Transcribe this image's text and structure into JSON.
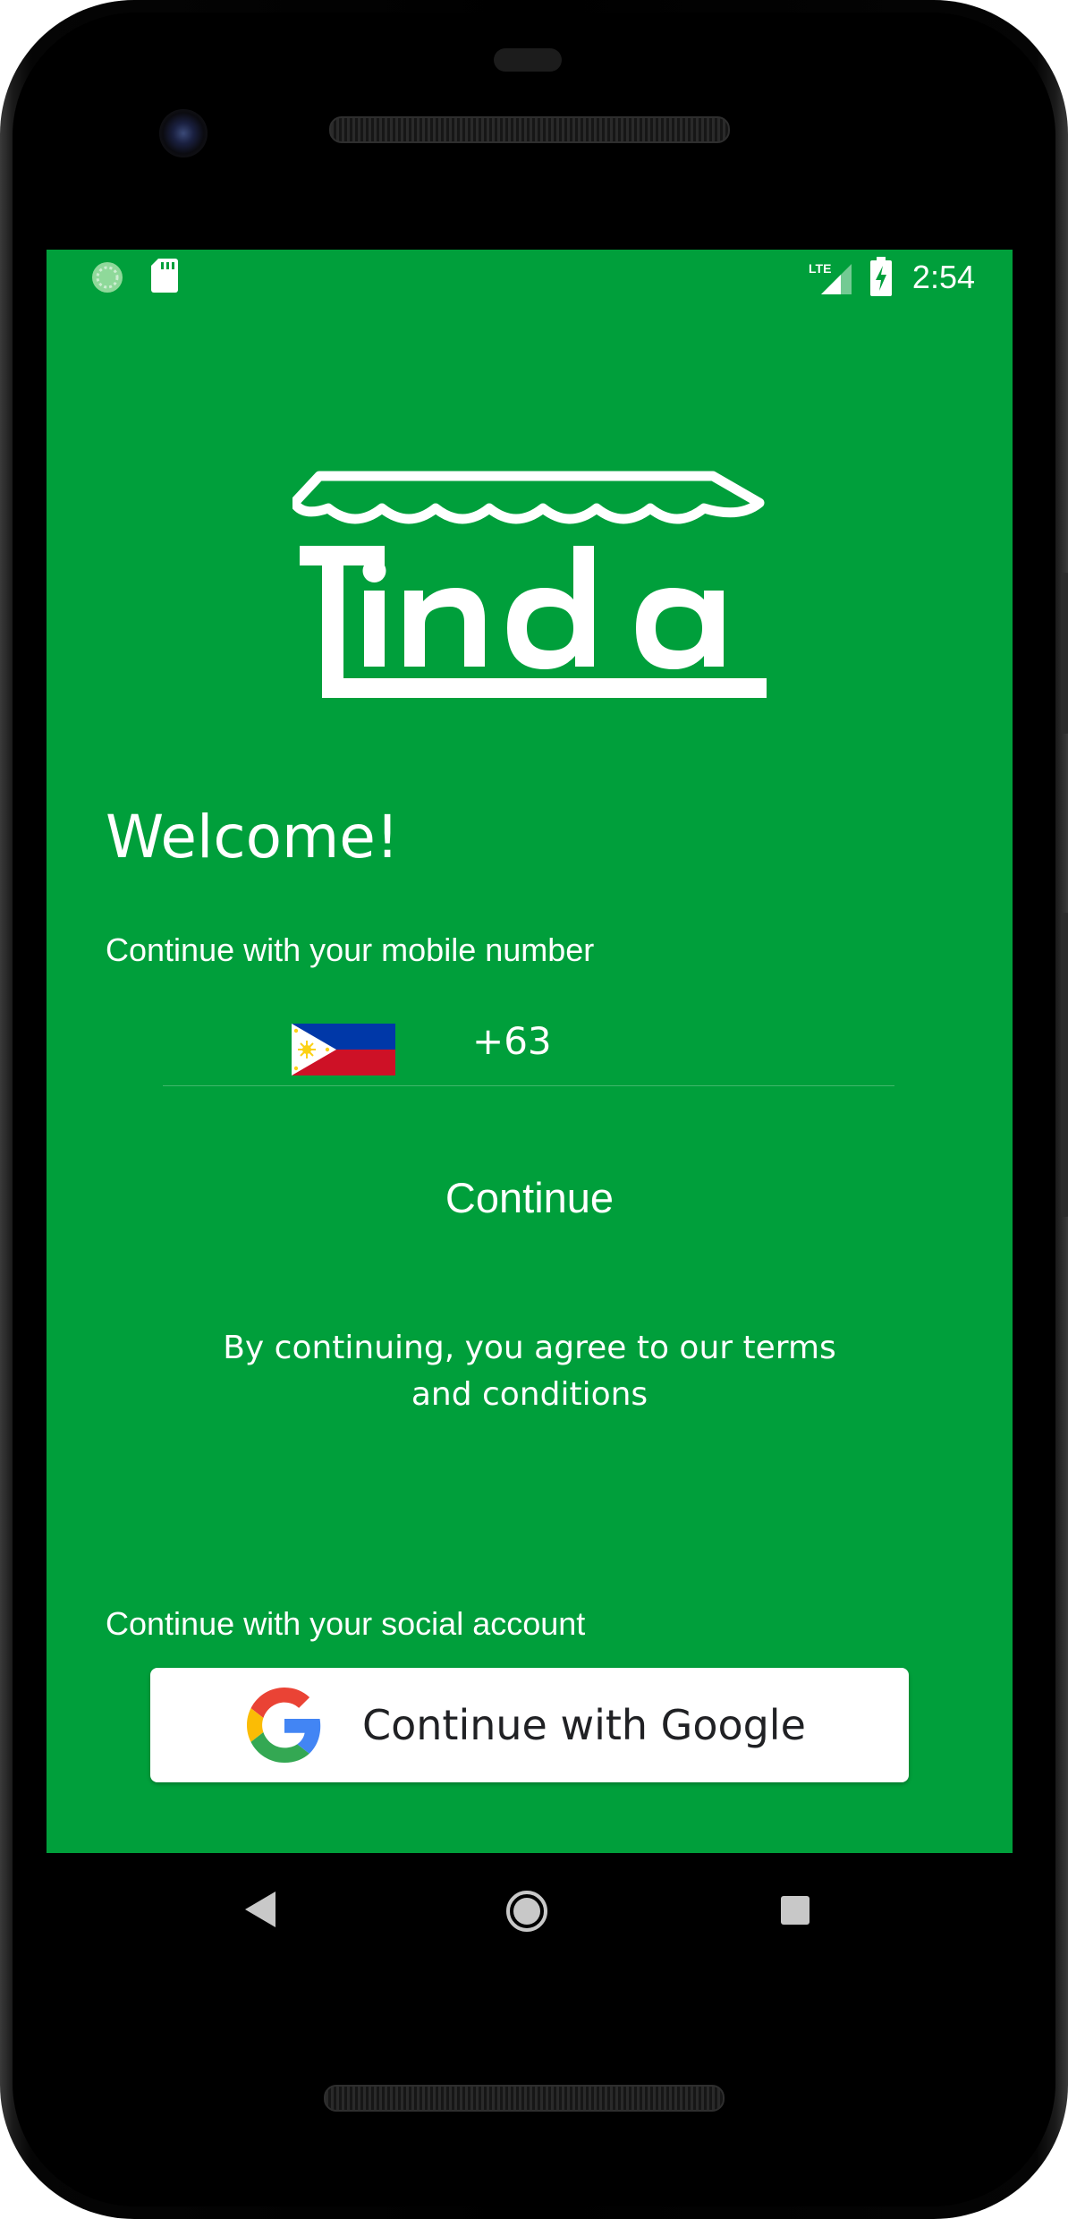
{
  "status_bar": {
    "time": "2:54",
    "network": "LTE",
    "icons": [
      "sync-icon",
      "sd-card-icon",
      "lte-signal-icon",
      "battery-charging-icon"
    ]
  },
  "app": {
    "brand": "Tinda",
    "brand_color": "#009f3b"
  },
  "login": {
    "welcome": "Welcome!",
    "mobile_prompt": "Continue with your mobile number",
    "country_flag": "philippines-flag-icon",
    "country_code": "+63",
    "continue_label": "Continue",
    "terms_line1": "By continuing, you agree to our terms",
    "terms_line2": "and conditions",
    "social_prompt": "Continue with your social account",
    "google_label": "Continue with Google"
  },
  "nav_bar": {
    "icons": [
      "back-icon",
      "home-icon",
      "recents-icon"
    ]
  }
}
